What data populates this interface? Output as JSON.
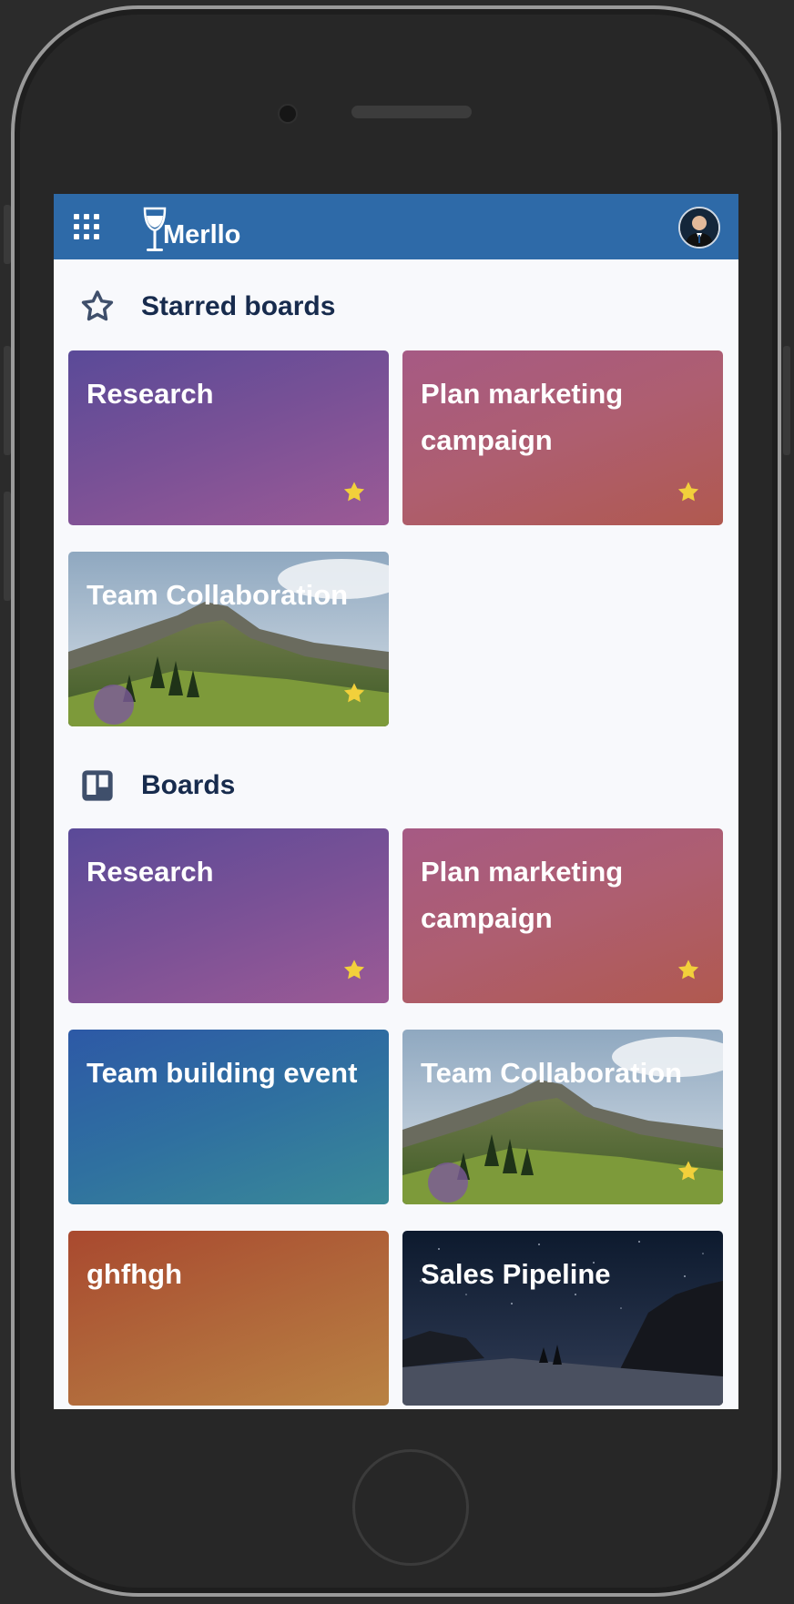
{
  "header": {
    "brand": "Merllo",
    "menu_icon": "apps-grid-icon",
    "avatar_icon": "user-avatar-icon"
  },
  "starred": {
    "title": "Starred boards",
    "icon": "star-outline-icon",
    "boards": [
      {
        "name": "Research",
        "starred": true,
        "background": "purple-gradient"
      },
      {
        "name": "Plan marketing campaign",
        "starred": true,
        "background": "rose-gradient"
      },
      {
        "name": "Team Collaboration",
        "starred": true,
        "background": "mountain-photo"
      }
    ]
  },
  "boards": {
    "title": "Boards",
    "icon": "board-icon",
    "items": [
      {
        "name": "Research",
        "starred": true,
        "background": "purple-gradient"
      },
      {
        "name": "Plan marketing campaign",
        "starred": true,
        "background": "rose-gradient"
      },
      {
        "name": "Team building event",
        "starred": false,
        "background": "blue-gradient"
      },
      {
        "name": "Team Collaboration",
        "starred": true,
        "background": "mountain-photo"
      },
      {
        "name": "ghfhgh",
        "starred": false,
        "background": "orange-gradient"
      },
      {
        "name": "Sales Pipeline",
        "starred": false,
        "background": "night-sky-photo"
      }
    ]
  },
  "colors": {
    "topbar": "#2e6aa8",
    "page_bg": "#f8f9fc",
    "heading_text": "#172b4d",
    "star": "#f2d03b"
  }
}
